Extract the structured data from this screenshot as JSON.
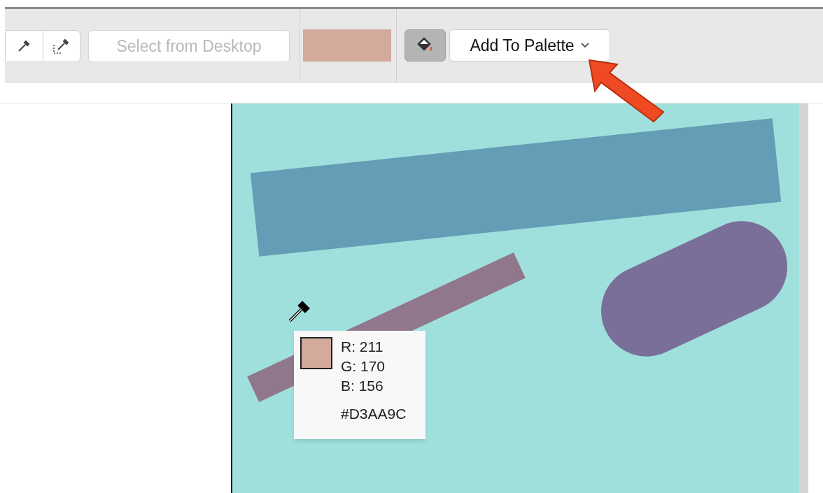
{
  "toolbar": {
    "select_from_desktop": {
      "label": "Select from Desktop",
      "disabled": true
    },
    "current_color": {
      "color": "#d3aa9c"
    },
    "fill_toggle": {
      "selected": true
    },
    "add_to_palette": {
      "label": "Add To Palette"
    }
  },
  "color_readout": {
    "color": "#d3aa9c",
    "lines": [
      "R: 211",
      "G: 170",
      "B: 156"
    ],
    "hex": "#D3AA9C"
  }
}
